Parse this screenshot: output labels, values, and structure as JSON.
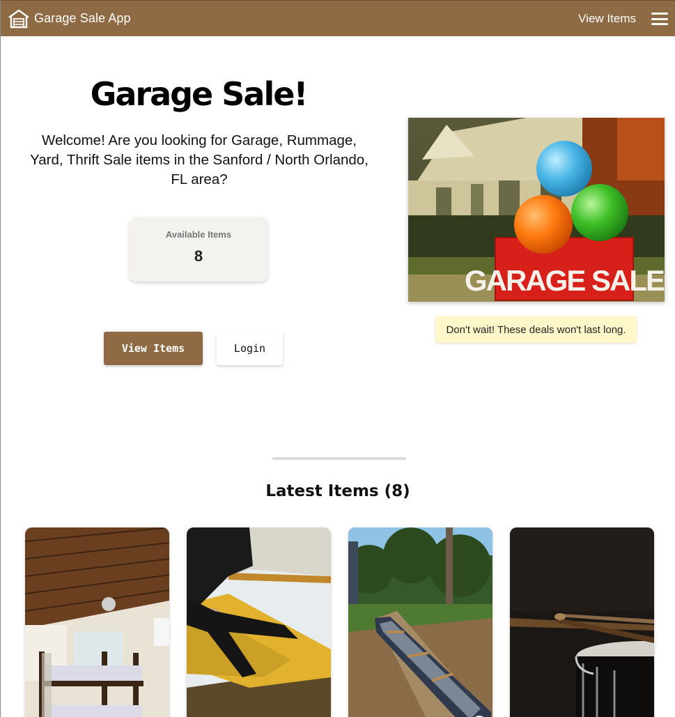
{
  "header": {
    "brand": "Garage Sale App",
    "brand_icon": "garage-icon",
    "nav_link": "View Items",
    "menu_icon": "hamburger-menu-icon",
    "bg_color": "#8e6b44"
  },
  "hero": {
    "title": "Garage Sale!",
    "subtitle": "Welcome! Are you looking for Garage, Rummage, Yard, Thrift Sale items in the Sanford / North Orlando, FL area?",
    "stat_label": "Available Items",
    "stat_value": "8",
    "primary_button": "View Items",
    "secondary_button": "Login",
    "image_sign_text": "GARAGE SALE",
    "note": "Don't wait! These deals won't last long."
  },
  "latest": {
    "title": "Latest Items (8)",
    "items": [
      {
        "photo": "bunk-bed-room-photo"
      },
      {
        "photo": "kayak-paddle-photo"
      },
      {
        "photo": "canoe-photo"
      },
      {
        "photo": "drumsticks-snare-photo"
      }
    ]
  }
}
